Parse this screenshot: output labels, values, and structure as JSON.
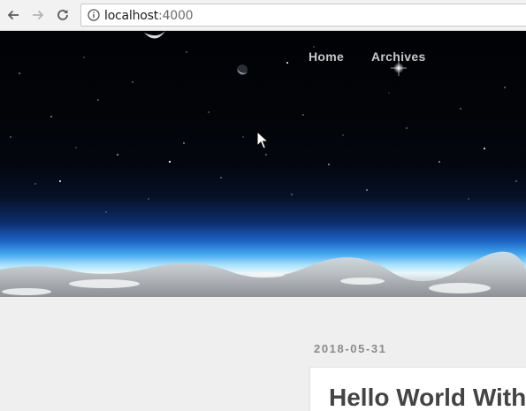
{
  "browser": {
    "url_host": "localhost",
    "url_port": ":4000",
    "icons": [
      "back-icon",
      "forward-icon",
      "reload-icon",
      "info-icon"
    ]
  },
  "nav": {
    "items": [
      {
        "label": "Home"
      },
      {
        "label": "Archives"
      }
    ]
  },
  "post": {
    "date": "2018-05-31",
    "title": "Hello World With"
  },
  "colors": {
    "page_bg": "#efefef",
    "nav_text": "#c8c8c8",
    "date_text": "#8a8a8a",
    "title_text": "#444444",
    "horizon_blue": "#44a8ef"
  }
}
